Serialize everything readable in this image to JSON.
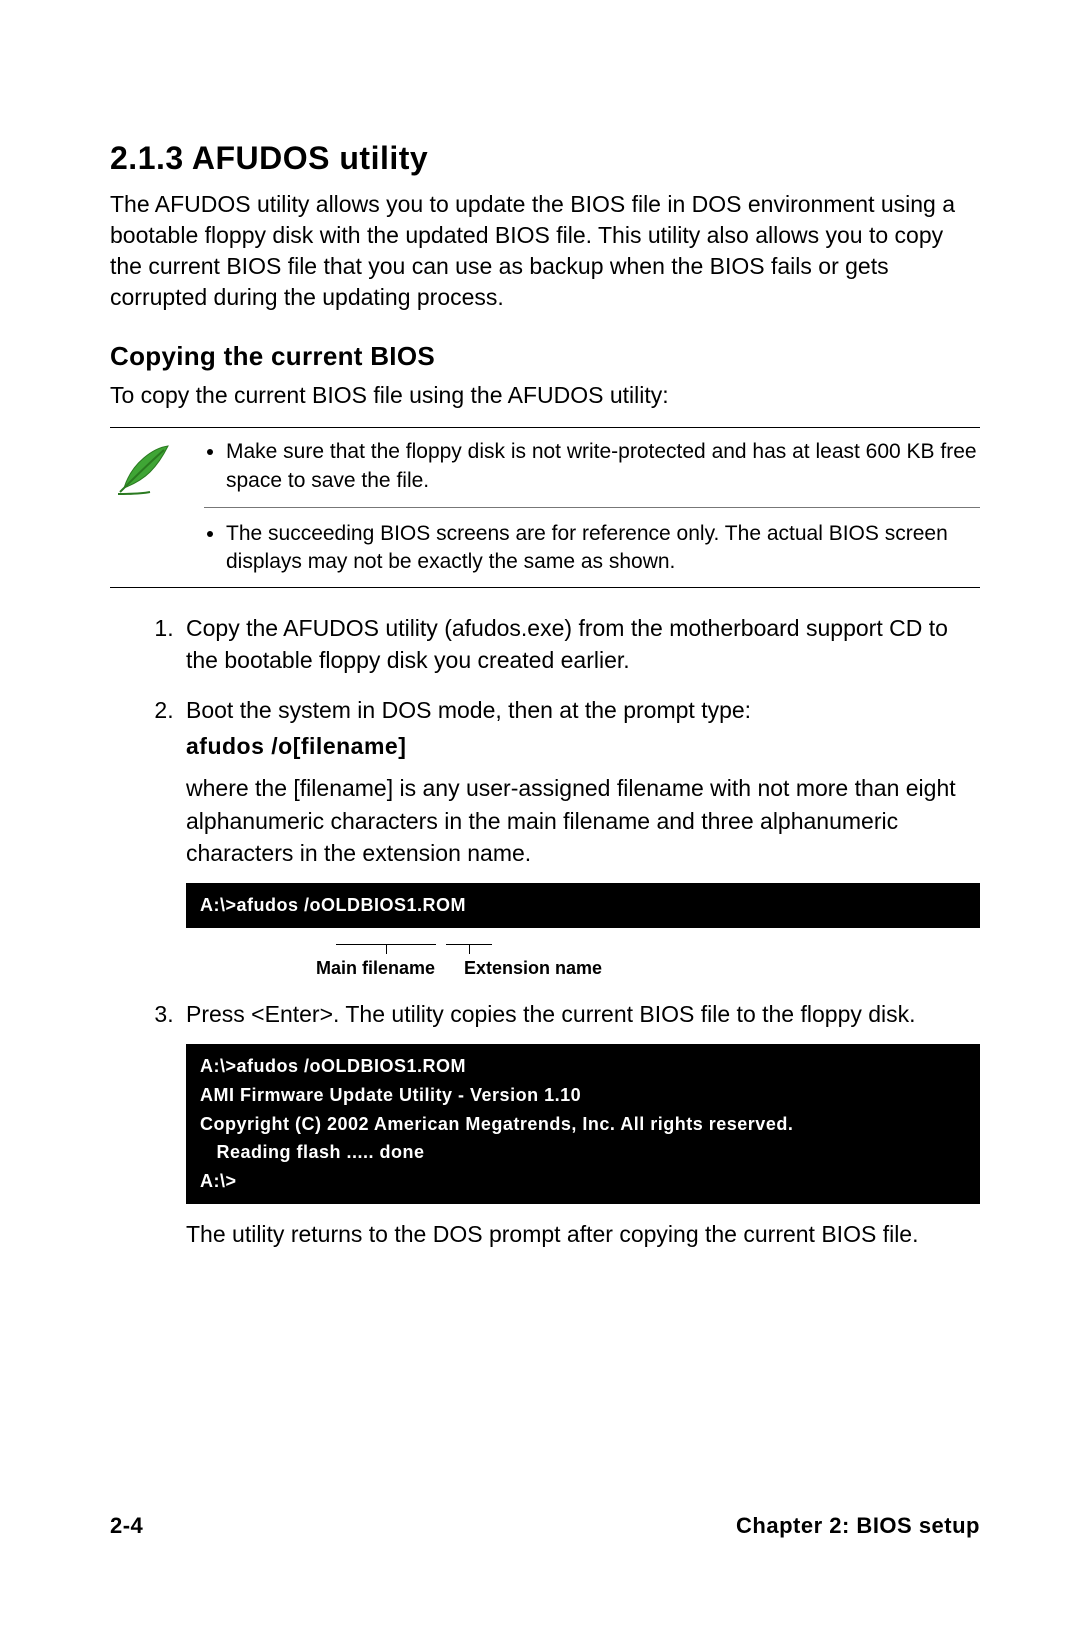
{
  "section": {
    "number_title": "2.1.3   AFUDOS utility",
    "intro": "The AFUDOS utility allows you to update the BIOS file in DOS environment using a bootable floppy disk with the updated BIOS file. This utility also allows you to copy the current BIOS file that you can use as backup when the BIOS fails or gets corrupted during the updating process."
  },
  "subsection": {
    "title": "Copying the current BIOS",
    "lead": "To copy the current BIOS file using the AFUDOS utility:"
  },
  "notes": {
    "item1": "Make sure that the floppy disk is not write-protected and has at least 600 KB free space to save the file.",
    "item2": "The succeeding BIOS screens are for reference only. The actual BIOS screen displays may not be exactly the same as shown."
  },
  "steps": {
    "s1": "Copy the AFUDOS utility (afudos.exe) from the motherboard support CD to the bootable floppy disk you created earlier.",
    "s2": "Boot the system in DOS mode, then at the prompt type:",
    "s2_cmd": "afudos /o[filename]",
    "s2_desc": "where the [filename] is any user-assigned filename with not more than eight alphanumeric characters in the main filename and three alphanumeric characters in the extension name.",
    "s3": "Press <Enter>. The utility copies the current BIOS file to the floppy disk.",
    "s3_after": "The utility returns to the DOS prompt after copying the current BIOS file."
  },
  "terminal1": {
    "line": "A:\\>afudos /oOLDBIOS1.ROM"
  },
  "bracket_labels": {
    "main": "Main filename",
    "ext": "Extension name"
  },
  "terminal2": {
    "l1": "A:\\>afudos /oOLDBIOS1.ROM",
    "l2": "AMI Firmware Update Utility - Version 1.10",
    "l3": "Copyright (C) 2002 American Megatrends, Inc. All rights reserved.",
    "l4": "   Reading flash ..... done",
    "l5": "A:\\>"
  },
  "footer": {
    "left": "2-4",
    "right": "Chapter 2: BIOS setup"
  }
}
